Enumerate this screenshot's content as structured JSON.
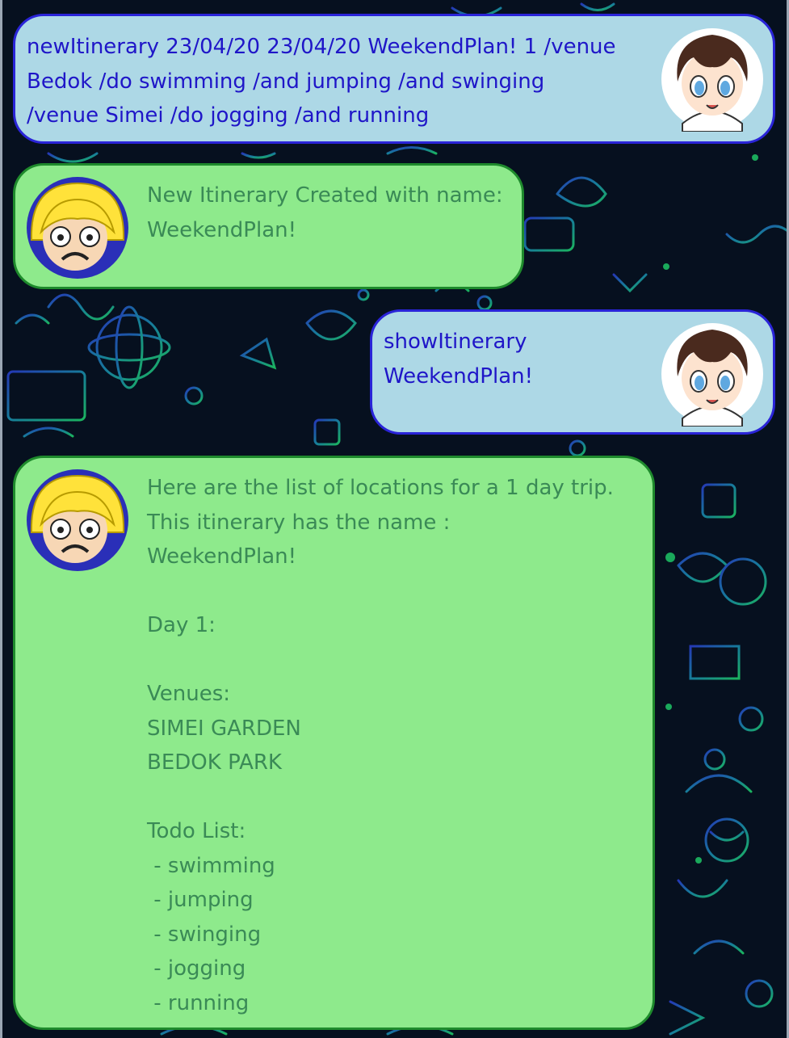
{
  "colors": {
    "background": "#06101f",
    "user_bubble": "#add8e6",
    "user_border": "#2a24d8",
    "user_text": "#1f16c8",
    "bot_bubble": "#8eea8c",
    "bot_border": "#1e8a2c",
    "bot_text": "#3a8a56"
  },
  "messages": [
    {
      "sender": "user",
      "avatar_icon": "brown-haired-boy-avatar-icon",
      "text": "newItinerary 23/04/20 23/04/20 WeekendPlan! 1 /venue\nBedok /do swimming /and jumping /and swinging\n/venue Simei /do jogging /and running"
    },
    {
      "sender": "bot",
      "avatar_icon": "blonde-character-avatar-icon",
      "text": "New Itinerary Created with name:\nWeekendPlan!"
    },
    {
      "sender": "user",
      "avatar_icon": "brown-haired-boy-avatar-icon",
      "text": "showItinerary\nWeekendPlan!"
    },
    {
      "sender": "bot",
      "avatar_icon": "blonde-character-avatar-icon",
      "text": "Here are the list of locations for a 1 day trip.\nThis itinerary has the name :\nWeekendPlan!\n\nDay 1:\n\nVenues:\nSIMEI GARDEN\nBEDOK PARK\n\nTodo List:\n - swimming\n - jumping\n - swinging\n - jogging\n - running"
    }
  ]
}
